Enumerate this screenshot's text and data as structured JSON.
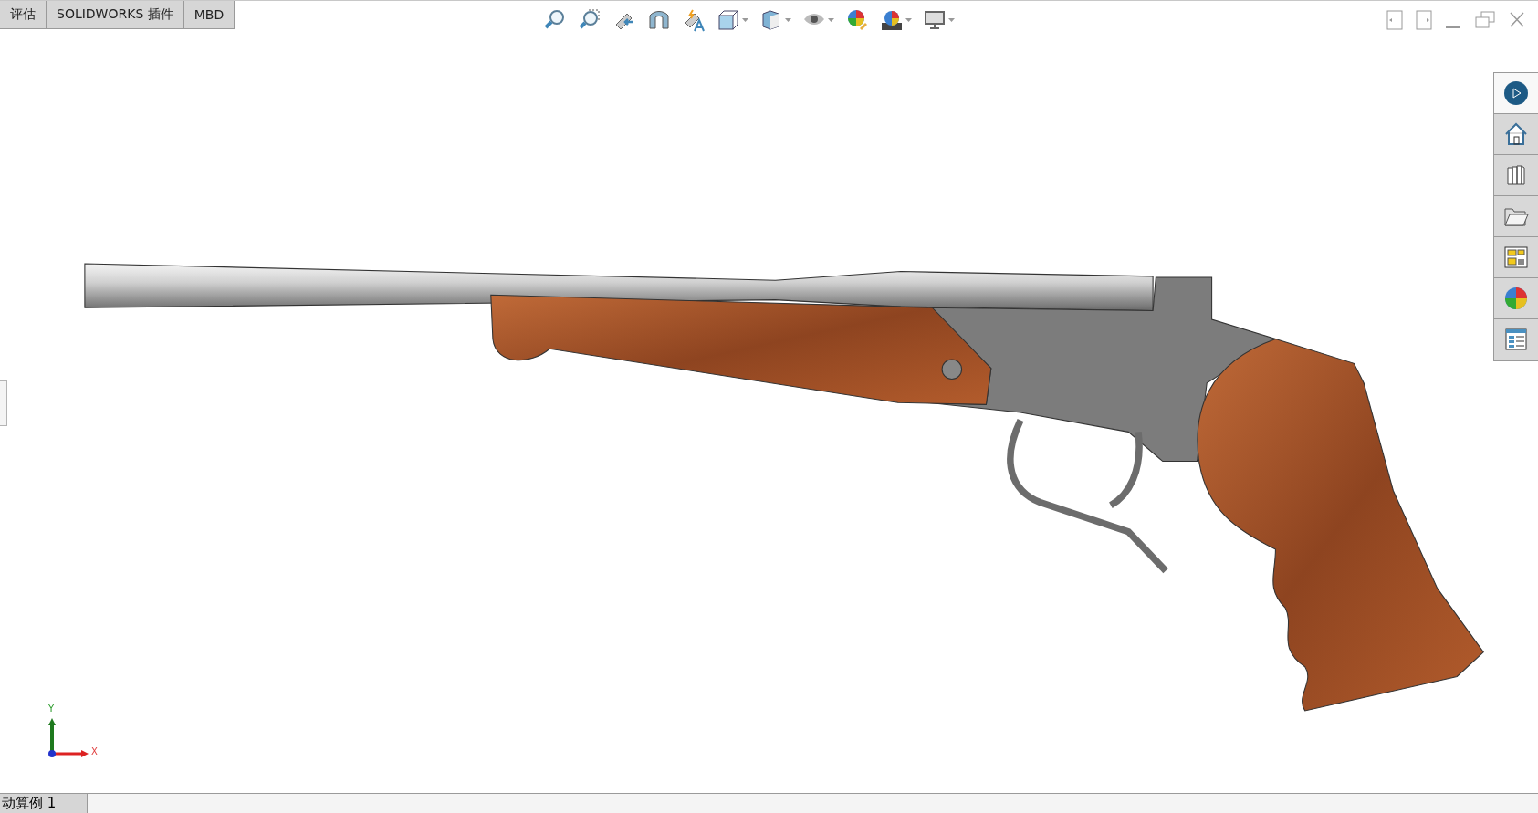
{
  "command_tabs": [
    {
      "label": "评估"
    },
    {
      "label": "SOLIDWORKS 插件"
    },
    {
      "label": "MBD"
    }
  ],
  "task_pane": [
    {
      "selected": true
    },
    {
      "selected": false
    },
    {
      "selected": false
    },
    {
      "selected": false
    },
    {
      "selected": false
    },
    {
      "selected": false
    },
    {
      "selected": false
    }
  ],
  "triad": {
    "y_label": "Y",
    "x_label": "X"
  },
  "bottom_tabs": [
    {
      "label": "动算例 1"
    }
  ]
}
